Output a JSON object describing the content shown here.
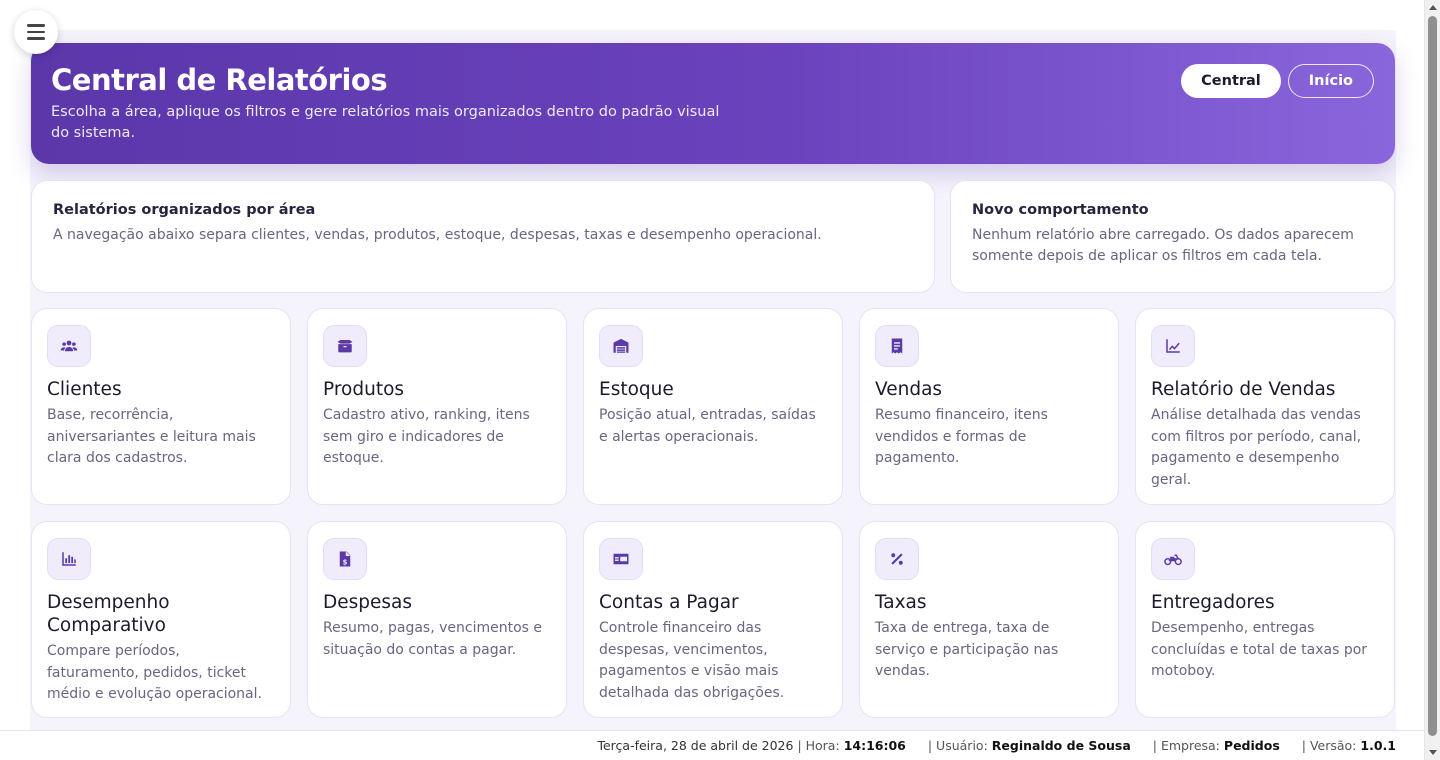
{
  "hero": {
    "title": "Central de Relatórios",
    "subtitle": "Escolha a área, aplique os filtros e gere relatórios mais organizados dentro do padrão visual do sistema.",
    "central_label": "Central",
    "inicio_label": "Início"
  },
  "info": [
    {
      "title": "Relatórios organizados por área",
      "text": "A navegação abaixo separa clientes, vendas, produtos, estoque, despesas, taxas e desempenho operacional."
    },
    {
      "title": "Novo comportamento",
      "text": "Nenhum relatório abre carregado. Os dados aparecem somente depois de aplicar os filtros em cada tela."
    }
  ],
  "cards": [
    {
      "title": "Clientes",
      "desc": "Base, recorrência, aniversariantes e leitura mais clara dos cadastros.",
      "icon": "users-icon"
    },
    {
      "title": "Produtos",
      "desc": "Cadastro ativo, ranking, itens sem giro e indicadores de estoque.",
      "icon": "box-icon"
    },
    {
      "title": "Estoque",
      "desc": "Posição atual, entradas, saídas e alertas operacionais.",
      "icon": "warehouse-icon"
    },
    {
      "title": "Vendas",
      "desc": "Resumo financeiro, itens vendidos e formas de pagamento.",
      "icon": "receipt-icon"
    },
    {
      "title": "Relatório de Vendas",
      "desc": "Análise detalhada das vendas com filtros por período, canal, pagamento e desempenho geral.",
      "icon": "line-chart-icon"
    },
    {
      "title": "Desempenho Comparativo",
      "desc": "Compare períodos, faturamento, pedidos, ticket médio e evolução operacional.",
      "icon": "bar-chart-icon"
    },
    {
      "title": "Despesas",
      "desc": "Resumo, pagas, vencimentos e situação do contas a pagar.",
      "icon": "invoice-dollar-icon"
    },
    {
      "title": "Contas a Pagar",
      "desc": "Controle financeiro das despesas, vencimentos, pagamentos e visão mais detalhada das obrigações.",
      "icon": "money-bill-icon"
    },
    {
      "title": "Taxas",
      "desc": "Taxa de entrega, taxa de serviço e participação nas vendas.",
      "icon": "percent-icon"
    },
    {
      "title": "Entregadores",
      "desc": "Desempenho, entregas concluídas e total de taxas por motoboy.",
      "icon": "motorcycle-icon"
    }
  ],
  "footer": {
    "date": "Terça-feira, 28 de abril de 2026",
    "hora_label": "| Hora:",
    "hora": "14:16:06",
    "usuario_label": "| Usuário:",
    "usuario": "Reginaldo de Sousa",
    "empresa_label": "| Empresa:",
    "empresa": "Pedidos",
    "versao_label": "| Versão:",
    "versao": "1.0.1"
  },
  "colors": {
    "accent": "#5b37aa",
    "accent_light": "#8a66dc",
    "card_icon_bg": "#f1ecfc"
  }
}
